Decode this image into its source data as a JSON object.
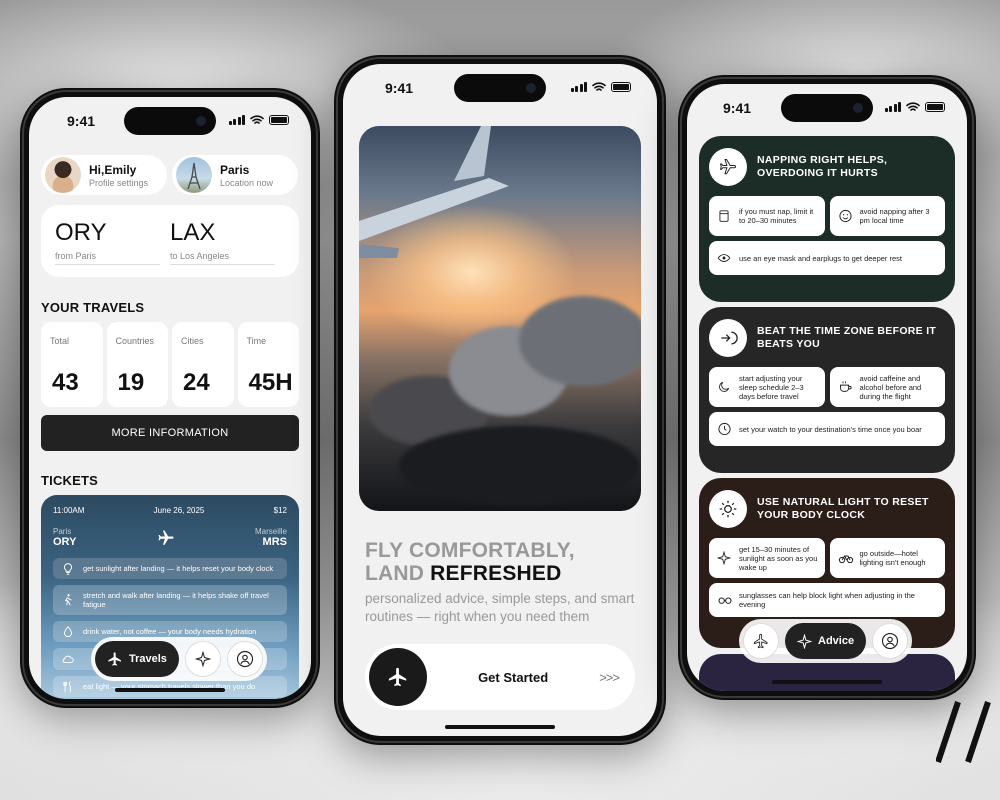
{
  "status_time": "9:41",
  "colors": {
    "dark_green": "#1c2d27",
    "charcoal": "#262626",
    "brown": "#2b1d18",
    "navy": "#2d4a61"
  },
  "travels_screen": {
    "profile": {
      "name": "Hi,Emily",
      "subtitle": "Profile settings"
    },
    "location": {
      "name": "Paris",
      "subtitle": "Location now"
    },
    "route": {
      "from_code": "ORY",
      "from_label": "from Paris",
      "to_code": "LAX",
      "to_label": "to Los Angeles"
    },
    "your_travels_title": "YOUR TRAVELS",
    "stats": [
      {
        "label": "Total",
        "value": "43"
      },
      {
        "label": "Countries",
        "value": "19"
      },
      {
        "label": "Cities",
        "value": "24"
      },
      {
        "label": "Time",
        "value": "45H"
      }
    ],
    "more_button": "MORE INFORMATION",
    "tickets_title": "TICKETS",
    "ticket": {
      "time": "11:00AM",
      "date": "June 26, 2025",
      "price": "$12",
      "from_city": "Paris",
      "from_code": "ORY",
      "to_city": "Marseille",
      "to_code": "MRS",
      "tips": [
        {
          "text": "get sunlight after landing — it helps reset your body clock",
          "icon": "lightbulb-icon"
        },
        {
          "text": "stretch and walk after landing — it helps shake off travel fatigue",
          "icon": "walking-icon"
        },
        {
          "text": "drink water, not coffee — your body needs hydration",
          "icon": "water-icon"
        },
        {
          "text": "",
          "icon": "cloud-icon"
        },
        {
          "text": "eat light — your stomach travels slower than you do",
          "icon": "food-icon"
        }
      ]
    },
    "nav": {
      "active_label": "Travels",
      "active_icon": "plane-icon",
      "icons": [
        "sparkle-icon",
        "profile-icon"
      ]
    }
  },
  "welcome_screen": {
    "headline_light_1": "FLY COMFORTABLY,",
    "headline_light_2": "LAND ",
    "headline_dark": "REFRESHED",
    "subtitle": "personalized advice, simple steps, and smart routines — right when you need them",
    "cta_label": "Get Started",
    "cta_arrows": ">>>"
  },
  "advice_screen": {
    "cards": [
      {
        "title": "NAPPING RIGHT HELPS, OVERDOING IT HURTS",
        "icon": "plane-icon",
        "tips": [
          {
            "text": "if you must nap, limit it to 20–30 minutes",
            "icon": "timer-icon"
          },
          {
            "text": "avoid napping after 3 pm local time",
            "icon": "smiley-icon"
          },
          {
            "text": "use an eye mask and earplugs to get deeper rest",
            "icon": "eye-mask-icon"
          }
        ]
      },
      {
        "title": "BEAT THE TIME ZONE BEFORE IT BEATS YOU",
        "icon": "plane-rotate-icon",
        "tips": [
          {
            "text": "start adjusting your sleep schedule 2–3 days before travel",
            "icon": "moon-icon"
          },
          {
            "text": "avoid caffeine and alcohol before and during the flight",
            "icon": "coffee-icon"
          },
          {
            "text": "set your watch to your destination's time once you boar",
            "icon": "clock-icon"
          }
        ]
      },
      {
        "title": "USE NATURAL LIGHT TO RESET YOUR BODY CLOCK",
        "icon": "sun-icon",
        "tips": [
          {
            "text": "get 15–30 minutes of sunlight as soon as you wake up",
            "icon": "sparkle-icon"
          },
          {
            "text": "go outside—hotel lighting isn't enough",
            "icon": "bicycle-icon"
          },
          {
            "text": "sunglasses can help block light when adjusting in the evening",
            "icon": "sunglasses-icon"
          }
        ]
      }
    ],
    "nav": {
      "active_label": "Advice",
      "active_icon": "sparkle-icon",
      "icons": [
        "plane-icon",
        "profile-icon"
      ]
    }
  }
}
